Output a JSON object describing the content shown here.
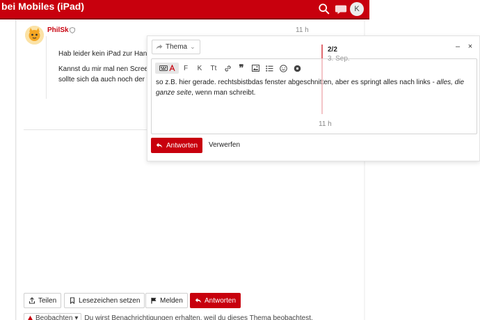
{
  "header": {
    "title": "bei Mobiles (iPad)",
    "avatar_letter": "K",
    "colors": {
      "brand": "#c8000d"
    }
  },
  "post": {
    "username": "PhilSk",
    "time": "11 h",
    "para1": "Hab leider kein iPad zur Hand",
    "para2_line1": "Kannst du mir mal nen Screen",
    "para2_line2": "sollte sich da auch noch der f"
  },
  "composer": {
    "topic_label": "Thema",
    "text_plain1": "so z.B. hier gerade. rechtsbistbdas fenster abgeschnitten, aber es springt alles nach links - ",
    "text_italic1": "alles, die ganze seite",
    "text_plain2": ", wenn man schreibt.",
    "timestamp": "11 h",
    "reply_label": "Antworten",
    "discard_label": "Verwerfen",
    "toolbar": {
      "bold": "F",
      "italic": "K",
      "heading": "Tt"
    }
  },
  "timeline": {
    "counter": "2/2",
    "date": "3. Sep."
  },
  "actions": {
    "share": "Teilen",
    "bookmark": "Lesezeichen setzen",
    "flag": "Melden",
    "reply": "Antworten"
  },
  "notification": {
    "level": "Beobachten",
    "text": "Du wirst Benachrichtigungen erhalten, weil du dieses Thema beobachtest."
  }
}
